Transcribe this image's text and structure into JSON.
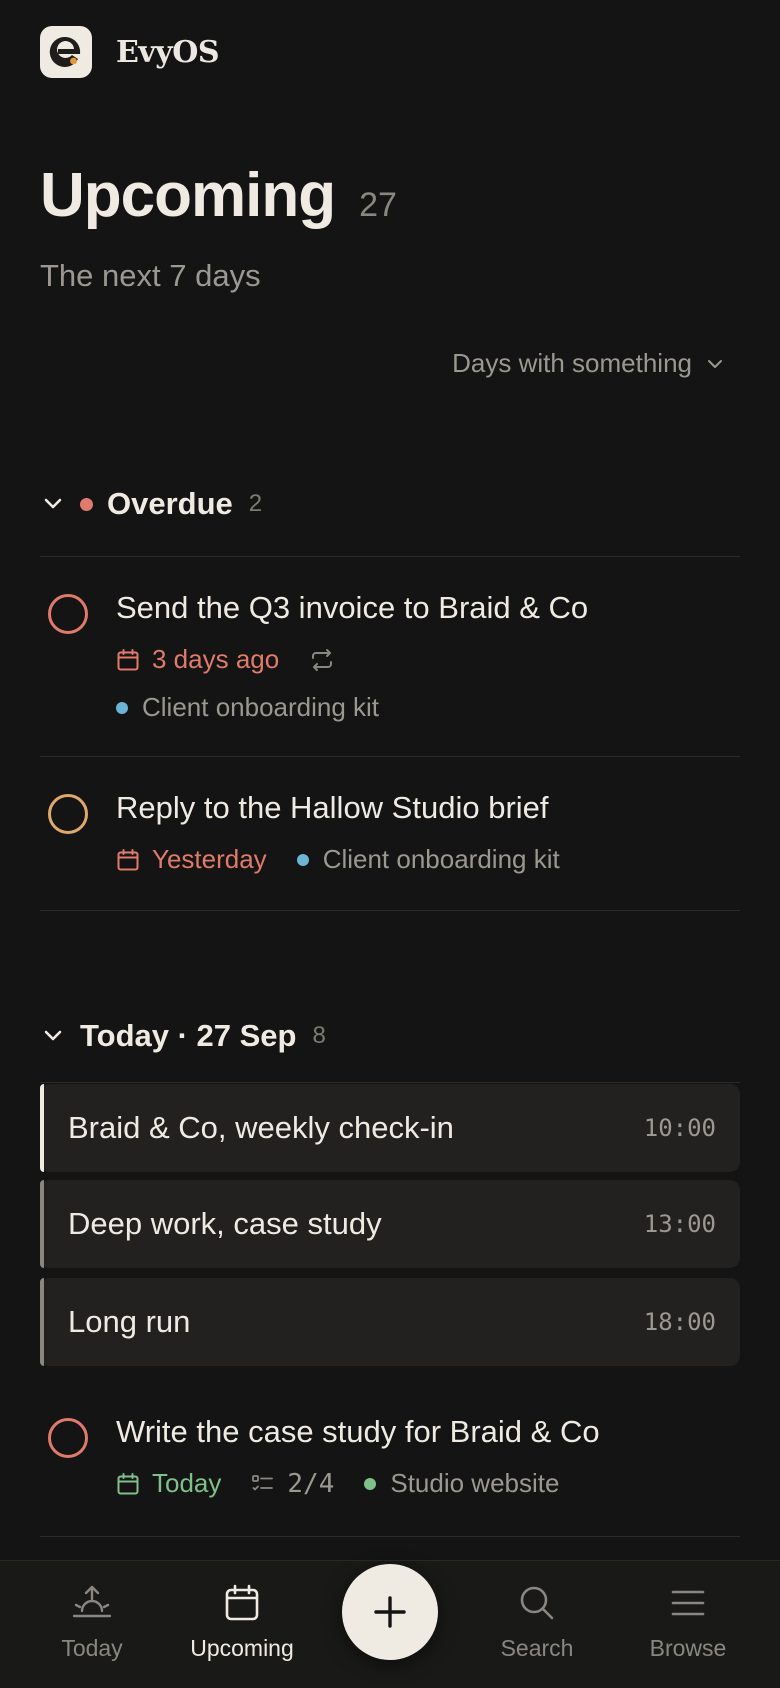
{
  "app": {
    "name": "EvyOS",
    "logo_letter": "e"
  },
  "header": {
    "title": "Upcoming",
    "count": "27",
    "subtitle": "The next 7 days",
    "filter_label": "Days with something"
  },
  "overdue": {
    "title": "Overdue",
    "count": "2",
    "tasks": [
      {
        "title": "Send the Q3 invoice to Braid & Co",
        "due": "3 days ago",
        "repeating": true,
        "project": "Client onboarding kit",
        "check_color": "#e07a6a"
      },
      {
        "title": "Reply to the Hallow Studio brief",
        "due": "Yesterday",
        "project": "Client onboarding kit",
        "check_color": "#e0a86a"
      }
    ]
  },
  "today": {
    "title": "Today · 27 Sep",
    "count": "8",
    "events": [
      {
        "title": "Braid & Co, weekly check-in",
        "time": "10:00",
        "active": true
      },
      {
        "title": "Deep work, case study",
        "time": "13:00"
      },
      {
        "title": "Long run",
        "time": "18:00"
      }
    ],
    "tasks": [
      {
        "title": "Write the case study for Braid & Co",
        "due": "Today",
        "subtasks": "2/4",
        "project": "Studio website",
        "check_color": "#e07a6a"
      }
    ]
  },
  "nav": {
    "items": [
      {
        "label": "Today",
        "icon": "sunrise-icon"
      },
      {
        "label": "Upcoming",
        "icon": "calendar-icon",
        "active": true
      },
      {
        "label": "Search",
        "icon": "search-icon"
      },
      {
        "label": "Browse",
        "icon": "menu-icon"
      }
    ],
    "add_icon": "plus-icon"
  },
  "colors": {
    "background": "#141414",
    "overdue_accent": "#e07a6a",
    "today_accent": "#7fc08a",
    "project_blue": "#6ab4d4",
    "project_green": "#7fc08a",
    "logo_dot": "#e39a3b"
  }
}
